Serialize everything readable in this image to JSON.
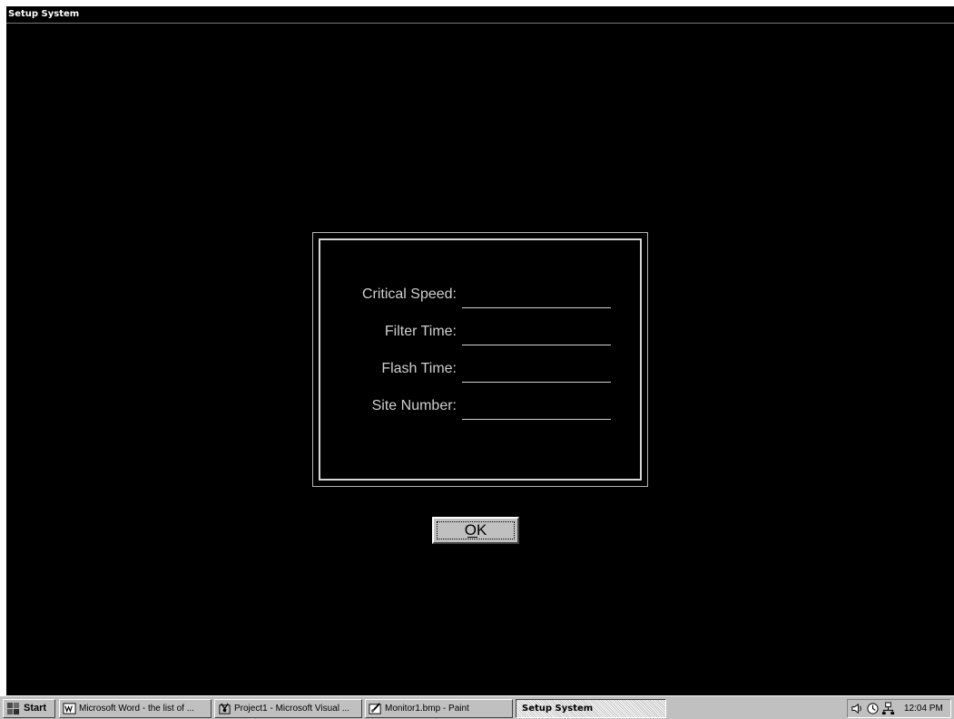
{
  "window": {
    "title": "Setup System"
  },
  "form": {
    "fields": [
      {
        "label": "Critical Speed:",
        "value": ""
      },
      {
        "label": "Filter Time:",
        "value": ""
      },
      {
        "label": "Flash Time:",
        "value": ""
      },
      {
        "label": "Site Number:",
        "value": ""
      }
    ],
    "ok_button": {
      "label": "OK",
      "accelerator": "O"
    }
  },
  "taskbar": {
    "start_label": "Start",
    "buttons": [
      {
        "label": "Microsoft Word - the list of ...",
        "icon": "word-icon"
      },
      {
        "label": "Project1 - Microsoft Visual ...",
        "icon": "visual-basic-icon"
      },
      {
        "label": "Monitor1.bmp - Paint",
        "icon": "paint-icon"
      },
      {
        "label": "Setup System",
        "icon": "",
        "active": true
      }
    ],
    "tray": {
      "icons": [
        "speaker-icon",
        "scheduler-icon",
        "network-icon"
      ],
      "clock": "12:04 PM"
    }
  },
  "colors": {
    "window_background": "#000000",
    "label_text": "#cfcfcf",
    "frame_border": "#d7d7d7",
    "taskbar_gray": "#c0c0c0"
  }
}
